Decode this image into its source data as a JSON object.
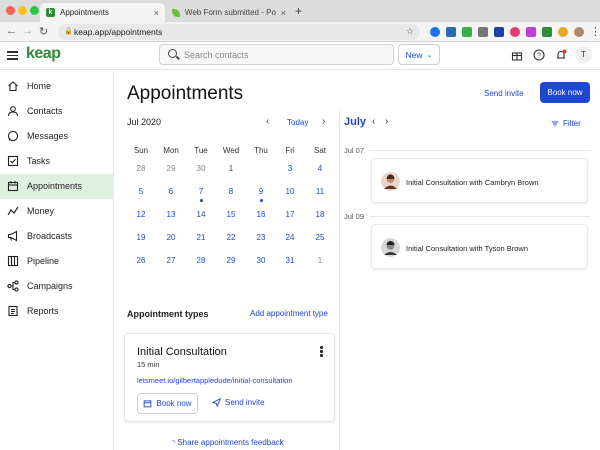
{
  "browser": {
    "tabs": [
      {
        "title": "Appointments",
        "close": "×"
      },
      {
        "title": "Web Form submitted - Powere",
        "close": "×"
      }
    ],
    "new_tab": "+",
    "back": "←",
    "forward": "→",
    "reload": "↻",
    "url": "keap.app/appointments"
  },
  "header": {
    "logo": "keap",
    "search_placeholder": "Search contacts",
    "new_label": "New",
    "avatar_initial": "T"
  },
  "sidebar": {
    "items": [
      {
        "label": "Home",
        "icon": "home-icon"
      },
      {
        "label": "Contacts",
        "icon": "person-icon"
      },
      {
        "label": "Messages",
        "icon": "chat-icon"
      },
      {
        "label": "Tasks",
        "icon": "checkbox-icon"
      },
      {
        "label": "Appointments",
        "icon": "calendar-icon",
        "active": true
      },
      {
        "label": "Money",
        "icon": "money-icon"
      },
      {
        "label": "Broadcasts",
        "icon": "megaphone-icon"
      },
      {
        "label": "Pipeline",
        "icon": "pipeline-icon"
      },
      {
        "label": "Campaigns",
        "icon": "campaign-icon"
      },
      {
        "label": "Reports",
        "icon": "report-icon"
      }
    ]
  },
  "main": {
    "title": "Appointments",
    "send_invite": "Send invite",
    "book_now": "Book now"
  },
  "calendar": {
    "month": "Jul 2020",
    "today": "Today",
    "prev": "‹",
    "next": "›",
    "weekdays": [
      "Sun",
      "Mon",
      "Tue",
      "Wed",
      "Thu",
      "Fri",
      "Sat"
    ],
    "weeks": [
      [
        "28",
        "29",
        "30",
        "1",
        "2",
        "3",
        "4"
      ],
      [
        "5",
        "6",
        "7",
        "8",
        "9",
        "10",
        "11"
      ],
      [
        "12",
        "13",
        "14",
        "15",
        "16",
        "17",
        "18"
      ],
      [
        "19",
        "20",
        "21",
        "22",
        "23",
        "24",
        "25"
      ],
      [
        "26",
        "27",
        "28",
        "29",
        "30",
        "31",
        "1"
      ]
    ],
    "selected": "2",
    "has_event": [
      "7",
      "9"
    ]
  },
  "appointment_types": {
    "title": "Appointment types",
    "add_label": "Add appointment type",
    "card": {
      "name": "Initial Consultation",
      "duration": "15 min",
      "link": "letsmeet.io/gilbertappledude/initial-consultation",
      "book_label": "Book now",
      "send_label": "Send invite"
    },
    "feedback": "Share appointments feedback"
  },
  "agenda": {
    "month": "July",
    "prev": "‹",
    "next": "›",
    "filter": "Filter",
    "days": [
      {
        "date": "Jul 07",
        "event": "Initial Consultation with Cambryn Brown"
      },
      {
        "date": "Jul 09",
        "event": "Initial Consultation with Tyson Brown"
      }
    ]
  },
  "colors": {
    "accent": "#1f46d1",
    "brand": "#2e8b3a",
    "active_nav": "#dff0df"
  }
}
